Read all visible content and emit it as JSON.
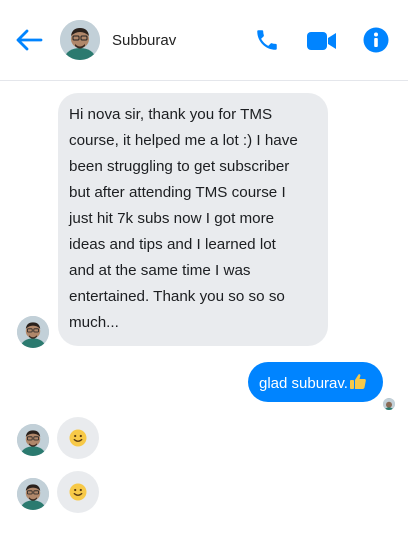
{
  "header": {
    "contact_name": "Subburav",
    "icons": [
      "back-arrow-icon",
      "phone-icon",
      "video-camera-icon",
      "info-icon"
    ]
  },
  "messages": [
    {
      "direction": "incoming",
      "text": "Hi nova sir, thank you for TMS\ncourse, it helped me a lot :) I have\nbeen struggling to get subscriber\nbut after attending TMS course I\njust hit 7k subs now I got more\nideas and tips and I learned lot\nand at the same time I was\nentertained. Thank you so so so\nmuch..."
    },
    {
      "direction": "outgoing",
      "text": "glad suburav.",
      "emoji": "thumbs-up-icon"
    },
    {
      "direction": "incoming",
      "emoji": "smiley-icon"
    },
    {
      "direction": "incoming",
      "emoji": "smiley-icon"
    }
  ],
  "colors": {
    "accent": "#0084ff",
    "incoming_bubble": "#e9ebee",
    "emoji_yellow": "#f7c948"
  }
}
